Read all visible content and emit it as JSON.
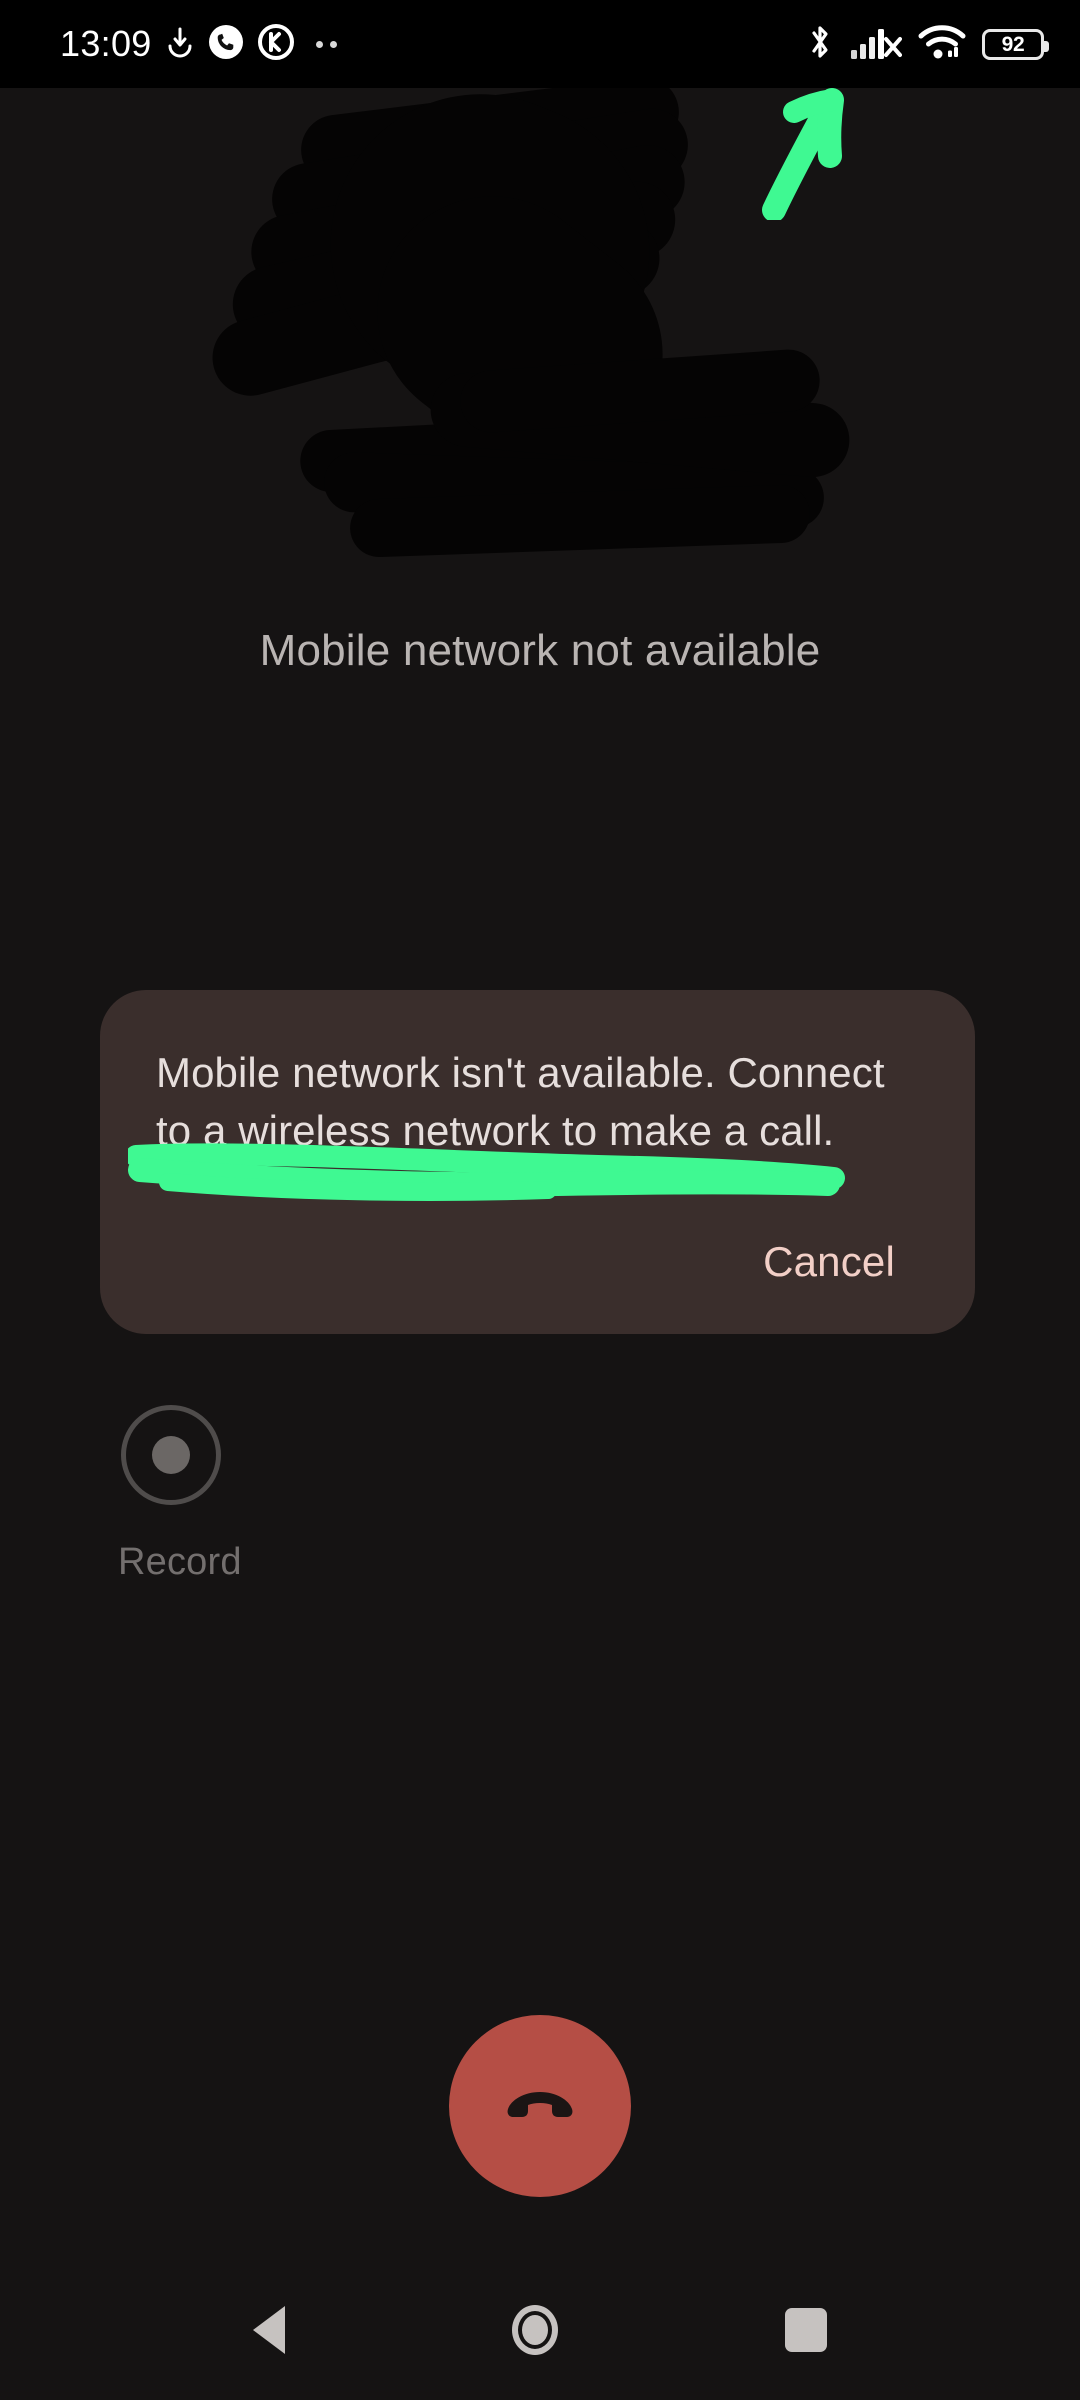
{
  "screen": {
    "app": "phone-in-call",
    "background_color": "#151313"
  },
  "status_bar": {
    "clock": "13:09",
    "left_icons": [
      "download-icon",
      "phone-call-icon",
      "app-k-icon",
      "more-notifications-dots-icon"
    ],
    "right_icons": [
      "bluetooth-icon",
      "cellular-signal-no-service-icon",
      "wifi-icon",
      "battery-icon"
    ],
    "battery_level": "92",
    "background_color": "#000000"
  },
  "call": {
    "caller_name": "",
    "caller_number": "",
    "status_text": "Mobile network not available",
    "redacted": true
  },
  "dialog": {
    "message": "Mobile network isn't available. Connect to a wireless network to make a call.",
    "cancel_label": "Cancel",
    "background_color": "#3a2e2c",
    "accent_color": "#f2cfc7"
  },
  "actions": {
    "record": {
      "label": "Record",
      "icon": "record-circle-icon"
    },
    "end_call": {
      "label": "",
      "icon": "end-call-handset-icon",
      "color": "#b54e45"
    }
  },
  "nav_bar": {
    "back_label": "",
    "home_label": "",
    "recents_label": "",
    "icons": [
      "back-triangle-icon",
      "home-circle-icon",
      "recents-square-icon"
    ]
  },
  "annotations": {
    "color": "#3ff992",
    "arrow": {
      "name": "green-arrow-annotation",
      "points_to": "cellular-signal-no-service-icon"
    },
    "underline": {
      "name": "green-underline-annotation",
      "underlines": "dialog-message"
    }
  }
}
